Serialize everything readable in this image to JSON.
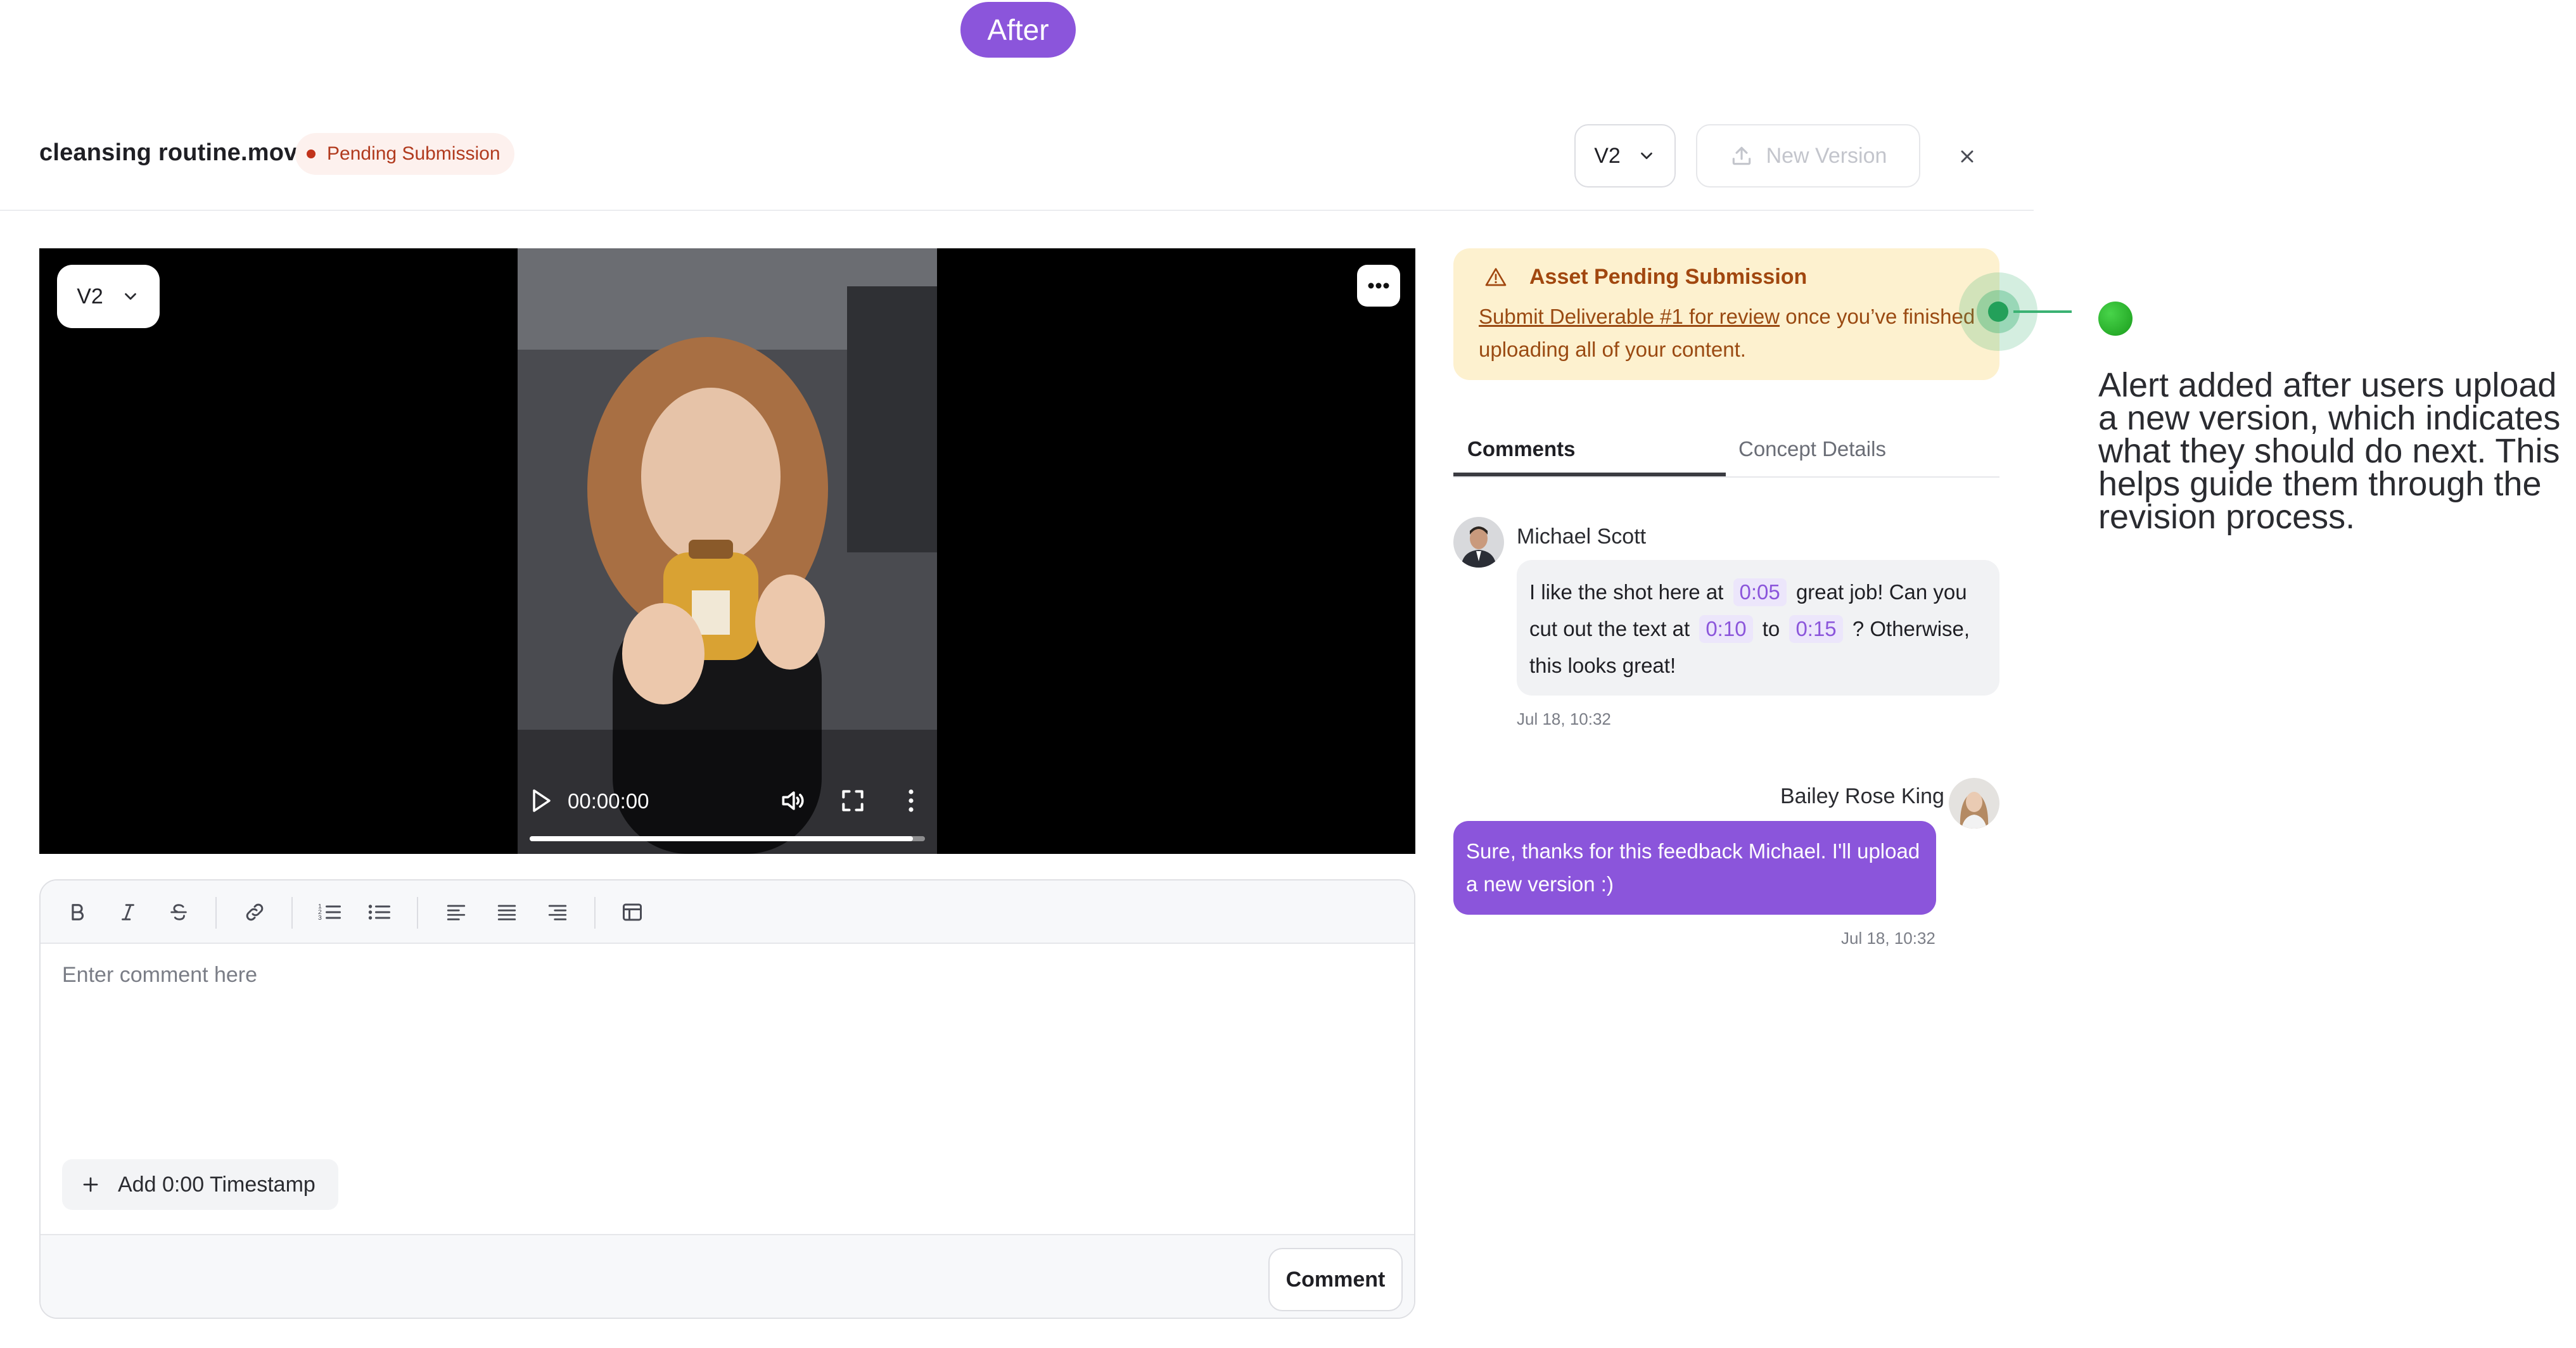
{
  "badge_after": "After",
  "header": {
    "file_name": "cleansing routine.mov",
    "status": "Pending Submission",
    "version_select": "V2",
    "new_version_label": "New Version"
  },
  "video": {
    "version_select": "V2",
    "time": "00:00:00",
    "progress": 0.97
  },
  "editor": {
    "placeholder": "Enter comment here",
    "timestamp_button": "Add 0:00 Timestamp",
    "submit_label": "Comment"
  },
  "alert": {
    "title": "Asset Pending Submission",
    "link_text": "Submit Deliverable #1 for review",
    "body_rest": " once you’ve finished uploading all of your content."
  },
  "tabs": [
    "Comments",
    "Concept Details"
  ],
  "comments": [
    {
      "author": "Michael Scott",
      "text_1": "I like the shot here at",
      "tc_1": "0:05",
      "text_2": "great job! Can you cut out the text at",
      "tc_2": "0:10",
      "text_3": "to",
      "tc_3": "0:15",
      "text_4": "? Otherwise, this looks great!",
      "time": "Jul 18, 10:32"
    },
    {
      "author": "Bailey Rose King",
      "text": "Sure, thanks for this feedback Michael. I'll upload a new version :)",
      "time": "Jul 18, 10:32"
    }
  ],
  "annotation": "Alert added after users upload a new version, which indicates what they should do next. This helps guide them through the revision process.",
  "colors": {
    "accent": "#8b55db",
    "alert_bg": "#fdf1cf",
    "alert_text": "#a1470f",
    "status_red": "#c1331b",
    "marker_green": "#23a05a"
  }
}
